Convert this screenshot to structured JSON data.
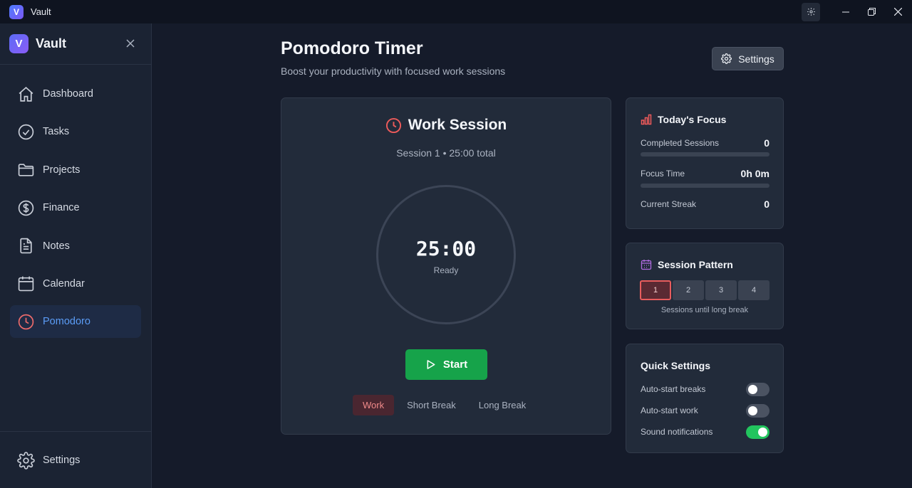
{
  "window": {
    "logo_letter": "V",
    "title": "Vault"
  },
  "sidebar": {
    "logo_letter": "V",
    "app_name": "Vault",
    "items": [
      {
        "label": "Dashboard",
        "icon": "home-icon"
      },
      {
        "label": "Tasks",
        "icon": "check-circle-icon"
      },
      {
        "label": "Projects",
        "icon": "folder-icon"
      },
      {
        "label": "Finance",
        "icon": "dollar-icon"
      },
      {
        "label": "Notes",
        "icon": "document-icon"
      },
      {
        "label": "Calendar",
        "icon": "calendar-icon"
      },
      {
        "label": "Pomodoro",
        "icon": "clock-icon",
        "active": true
      }
    ],
    "footer": {
      "label": "Settings",
      "icon": "gear-icon"
    }
  },
  "header": {
    "title": "Pomodoro Timer",
    "subtitle": "Boost your productivity with focused work sessions",
    "settings_label": "Settings"
  },
  "timer": {
    "title": "Work Session",
    "subtitle": "Session 1 • 25:00 total",
    "time": "25:00",
    "status": "Ready",
    "start_label": "Start",
    "modes": [
      {
        "label": "Work",
        "active": true
      },
      {
        "label": "Short Break",
        "active": false
      },
      {
        "label": "Long Break",
        "active": false
      }
    ]
  },
  "focus": {
    "title": "Today's Focus",
    "completed_label": "Completed Sessions",
    "completed_value": "0",
    "completed_progress": 0,
    "focus_label": "Focus Time",
    "focus_value": "0h 0m",
    "focus_progress": 0,
    "streak_label": "Current Streak",
    "streak_value": "0"
  },
  "pattern": {
    "title": "Session Pattern",
    "sessions": [
      "1",
      "2",
      "3",
      "4"
    ],
    "current_index": 0,
    "caption": "Sessions until long break"
  },
  "quick": {
    "title": "Quick Settings",
    "toggles": [
      {
        "label": "Auto-start breaks",
        "on": false
      },
      {
        "label": "Auto-start work",
        "on": false
      },
      {
        "label": "Sound notifications",
        "on": true
      }
    ]
  },
  "colors": {
    "accent_blue": "#5b9cf6",
    "accent_red": "#e85d5d",
    "start_green": "#16a34a",
    "toggle_on": "#22c55e"
  }
}
